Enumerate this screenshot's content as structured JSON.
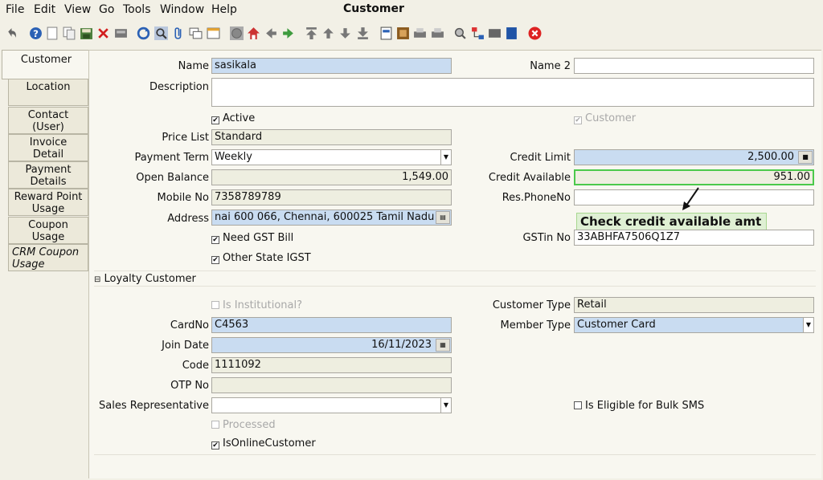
{
  "menu": [
    "File",
    "Edit",
    "View",
    "Go",
    "Tools",
    "Window",
    "Help"
  ],
  "window_title": "Customer",
  "toolbar_icons": [
    "undo-icon",
    "help-icon",
    "new-icon",
    "copy-icon",
    "save-icon",
    "delete-icon",
    "print-preview-icon",
    "refresh-icon",
    "find-icon",
    "attachment-icon",
    "chat-icon",
    "grid-toggle-icon",
    "history-icon",
    "home-icon",
    "back-icon",
    "forward-icon",
    "first-record-icon",
    "previous-record-icon",
    "next-record-icon",
    "last-record-icon",
    "report-icon",
    "archive-icon",
    "print-icon",
    "print2-icon",
    "zoom-icon",
    "workflow-icon",
    "process-icon",
    "product-info-icon",
    "exit-icon"
  ],
  "tabs": [
    {
      "label": "Customer"
    },
    {
      "label": "Location"
    },
    {
      "label": "Contact (User)"
    },
    {
      "label": "Invoice Detail"
    },
    {
      "label": "Payment Details"
    },
    {
      "label": "Reward Point Usage"
    },
    {
      "label": "Coupon Usage"
    },
    {
      "label": "CRM Coupon Usage"
    }
  ],
  "form": {
    "name_label": "Name",
    "name_value": "sasikala",
    "name2_label": "Name 2",
    "name2_value": "",
    "description_label": "Description",
    "description_value": "",
    "active_label": "Active",
    "customer_label": "Customer",
    "price_list_label": "Price List",
    "price_list_value": "Standard",
    "payment_term_label": "Payment Term",
    "payment_term_value": "Weekly",
    "credit_limit_label": "Credit Limit",
    "credit_limit_value": "2,500.00",
    "open_balance_label": "Open Balance",
    "open_balance_value": "1,549.00",
    "credit_available_label": "Credit Available",
    "credit_available_value": "951.00",
    "mobile_label": "Mobile No",
    "mobile_value": "7358789789",
    "res_phone_label": "Res.PhoneNo",
    "res_phone_value": "",
    "address_label": "Address",
    "address_value": "nai 600 066, Chennai,  600025 Tamil Nadu",
    "need_gst_label": "Need GST Bill",
    "gstin_label": "GSTin No",
    "gstin_value": "33ABHFA7506Q1Z7",
    "other_state_label": "Other State IGST"
  },
  "callout": "Check credit available amt",
  "loyalty": {
    "section_label": "Loyalty Customer",
    "is_institutional_label": "Is Institutional?",
    "customer_type_label": "Customer Type",
    "customer_type_value": "Retail",
    "cardno_label": "CardNo",
    "cardno_value": "C4563",
    "member_type_label": "Member Type",
    "member_type_value": "Customer Card",
    "join_date_label": "Join Date",
    "join_date_value": "16/11/2023",
    "code_label": "Code",
    "code_value": "1111092",
    "otp_label": "OTP No",
    "otp_value": "",
    "sales_rep_label": "Sales Representative",
    "sales_rep_value": "",
    "bulk_sms_label": "Is Eligible for Bulk SMS",
    "processed_label": "Processed",
    "is_online_label": "IsOnlineCustomer"
  }
}
